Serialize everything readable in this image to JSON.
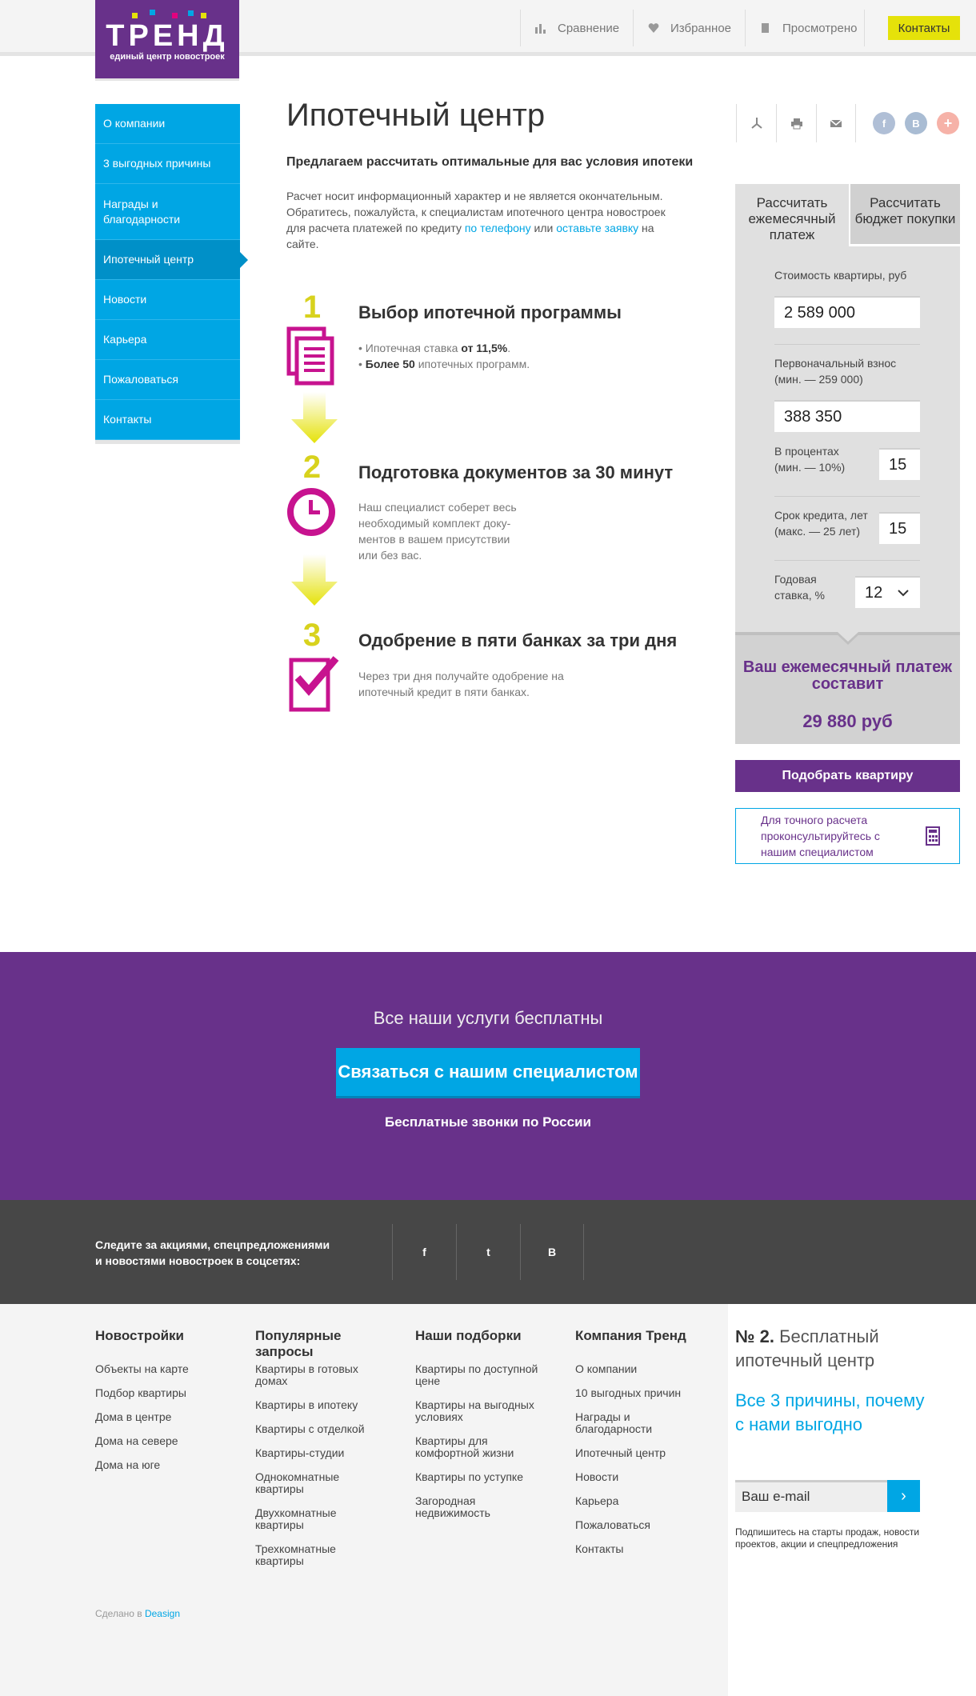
{
  "brand": {
    "word": "ТРЕНД",
    "tagline": "единый центр новостроек",
    "dots": [
      "#e5e20a",
      "#00a6e4",
      "#e4007e",
      "#00a6e4",
      "#e5e20a"
    ]
  },
  "topnav": {
    "compare": "Сравнение",
    "favorites": "Избранное",
    "viewed": "Просмотрено",
    "contacts": "Контакты"
  },
  "sidebar": [
    "О компании",
    "3 выгодных причины",
    "Награды и благодарности",
    "Ипотечный центр",
    "Новости",
    "Карьера",
    "Пожаловаться",
    "Контакты"
  ],
  "page": {
    "title": "Ипотечный центр",
    "lead": "Предлагаем рассчитать оптимальные для вас условия ипотеки",
    "intro_1": "Расчет носит информационный характер и не является окончательным. Обратитесь, пожалуйста, к специалистам ипотечного центра новостроек для расчета платежей по кредиту ",
    "intro_link1": "по телефону",
    "intro_or": " или ",
    "intro_link2": "оставьте заявку",
    "intro_2": " на сайте."
  },
  "steps": [
    {
      "num": "1",
      "title": "Выбор ипотечной программы",
      "l1a": "• Ипотечная ставка ",
      "l1b": "от 11,5%",
      "l1c": ".",
      "l2a": "• ",
      "l2b": "Более 50",
      "l2c": " ипотечных программ."
    },
    {
      "num": "2",
      "title": "Подготовка документов за 30 минут",
      "text": "Наш специалист соберет весь необходимый комплект доку-ментов в вашем присутствии или без вас."
    },
    {
      "num": "3",
      "title": "Одобрение в пяти банках за три дня",
      "text": "Через три дня получайте одобрение на ипотечный кредит в пяти банках."
    }
  ],
  "share": {
    "fb": "f",
    "vk": "B",
    "plus": "+"
  },
  "calc": {
    "tab1": "Рассчитать ежемесячный платеж",
    "tab2": "Рассчитать бюджет покупки",
    "price_label": "Стоимость квартиры, руб",
    "price": "2 589 000",
    "down_label": "Первоначальный взнос (мин. — 259 000)",
    "down": "388 350",
    "pct_label": "В процентах (мин. — 10%)",
    "pct": "15",
    "term_label": "Срок кредита, лет (макс. — 25 лет)",
    "term": "15",
    "rate_label": "Годовая ставка, %",
    "rate": "12",
    "result_title": "Ваш ежемесячный платеж составит",
    "result_value": "29 880 руб"
  },
  "pick_button": "Подобрать квартиру",
  "consult": "Для точного расчета проконсультируйтесь с нашим специалистом",
  "band": {
    "title": "Все наши услуги бесплатны",
    "button": "Связаться с нашим специалистом",
    "sub": "Бесплатные звонки по России"
  },
  "social": {
    "text": "Следите за акциями, спецпредложениями и новостями новостроек в соцсетях:",
    "fb": "f",
    "tw": "t",
    "vk": "B"
  },
  "footer": [
    {
      "title": "Новостройки",
      "links": [
        "Объекты на карте",
        "Подбор квартиры",
        "Дома в центре",
        "Дома на севере",
        "Дома на юге"
      ]
    },
    {
      "title": "Популярные запросы",
      "links": [
        "Квартиры в готовых домах",
        "Квартиры в ипотеку",
        "Квартиры с отделкой",
        "Квартиры-студии",
        "Однокомнатные квартиры",
        "Двухкомнатные квартиры",
        "Трехкомнатные квартиры"
      ]
    },
    {
      "title": "Наши подборки",
      "links": [
        "Квартиры по доступной цене",
        "Квартиры на выгодных условиях",
        "Квартиры для комфортной жизни",
        "Квартиры по уступке",
        "Загородная недвижимость"
      ]
    },
    {
      "title": "Компания Тренд",
      "links": [
        "О компании",
        "10 выгодных причин",
        "Награды и благодарности",
        "Ипотечный центр",
        "Новости",
        "Карьера",
        "Пожаловаться",
        "Контакты"
      ]
    }
  ],
  "made": {
    "text": "Сделано в ",
    "brand": "Deasign"
  },
  "promo": {
    "num": "№ 2.",
    "title": "Бесплатный ипотечный центр",
    "blue": "Все 3 причины, почему с нами выгодно",
    "email_placeholder": "Ваш e-mail",
    "go": "›",
    "subscribe": "Подпишитесь на старты продаж, новости проектов, акции и спецпредложения"
  }
}
